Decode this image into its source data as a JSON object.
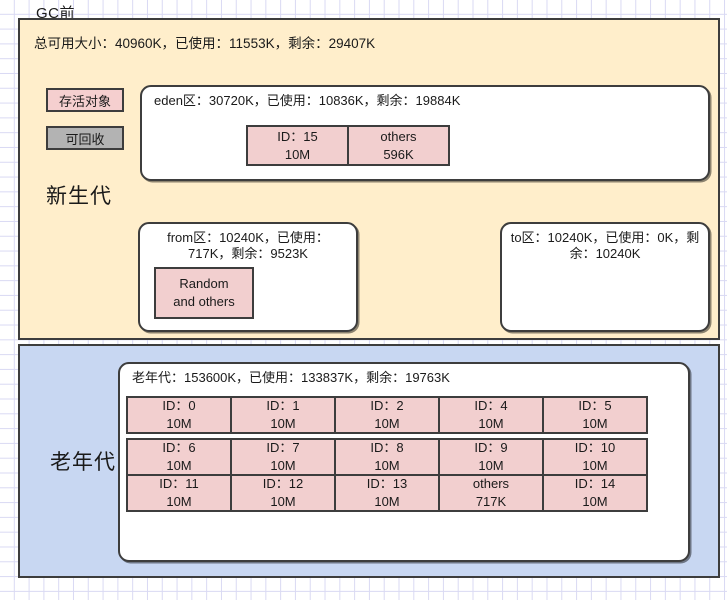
{
  "diagram": {
    "title": "GC前"
  },
  "young_gen": {
    "label": "新生代",
    "summary": "总可用大小：40960K，已使用：11553K，剩余：29407K",
    "bg_color": "#ffeecb",
    "legend": [
      {
        "name": "alive",
        "label": "存活对象",
        "color": "#f5cfcf"
      },
      {
        "name": "garbage",
        "label": "可回收",
        "color": "#b3b3b3"
      }
    ],
    "eden": {
      "title": "eden区：30720K，已使用：10836K，剩余：19884K",
      "objects": [
        {
          "id": "ID：15",
          "size": "10M"
        },
        {
          "id": "others",
          "size": "596K"
        }
      ]
    },
    "from": {
      "title": "from区：10240K，已使用：717K，剩余：9523K",
      "objects": [
        {
          "id": "Random",
          "size": "and others"
        }
      ]
    },
    "to": {
      "title": "to区：10240K，已使用：0K，剩余：10240K",
      "objects": []
    }
  },
  "old_gen": {
    "label": "老年代",
    "bg_color": "#c8d7f2",
    "region": {
      "title": "老年代：153600K，已使用：133837K，剩余：19763K",
      "rows": [
        [
          {
            "id": "ID：0",
            "size": "10M"
          },
          {
            "id": "ID：1",
            "size": "10M"
          },
          {
            "id": "ID：2",
            "size": "10M"
          },
          {
            "id": "ID：4",
            "size": "10M"
          },
          {
            "id": "ID：5",
            "size": "10M"
          }
        ],
        [
          {
            "id": "ID：6",
            "size": "10M"
          },
          {
            "id": "ID：7",
            "size": "10M"
          },
          {
            "id": "ID：8",
            "size": "10M"
          },
          {
            "id": "ID：9",
            "size": "10M"
          },
          {
            "id": "ID：10",
            "size": "10M"
          }
        ],
        [
          {
            "id": "ID：11",
            "size": "10M"
          },
          {
            "id": "ID：12",
            "size": "10M"
          },
          {
            "id": "ID：13",
            "size": "10M"
          },
          {
            "id": "others",
            "size": "717K"
          },
          {
            "id": "ID：14",
            "size": "10M"
          }
        ]
      ]
    }
  },
  "colors": {
    "object_fill": "#f2cfcf",
    "border": "#3d3d3d",
    "grid_line": "#d9d9f3"
  }
}
